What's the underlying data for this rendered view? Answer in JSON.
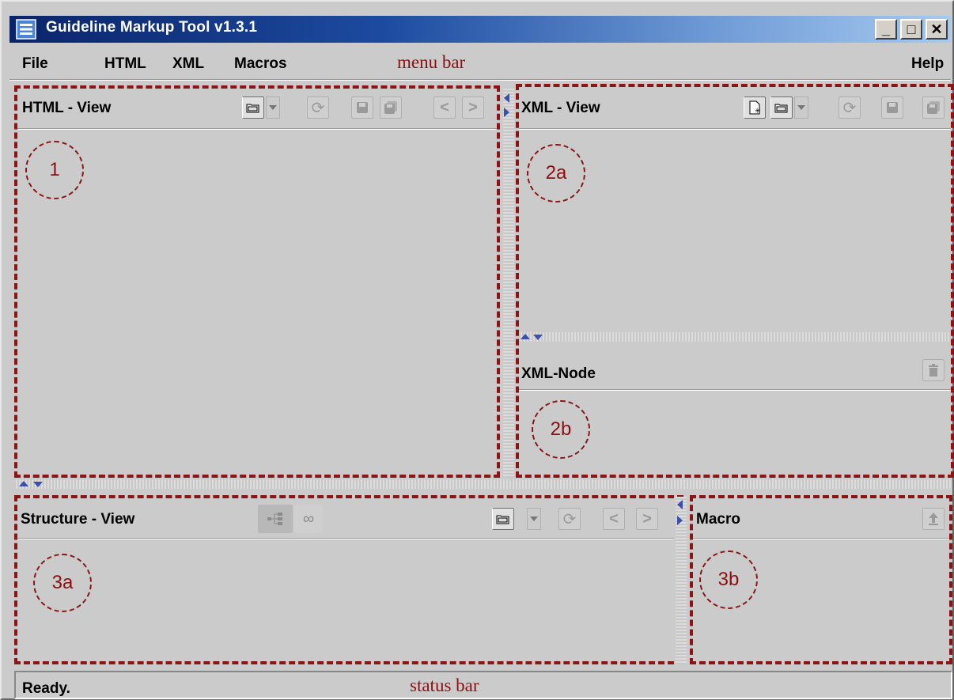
{
  "window": {
    "title": "Guideline Markup Tool v1.3.1"
  },
  "menu": {
    "file": "File",
    "html": "HTML",
    "xml": "XML",
    "macros": "Macros",
    "help": "Help"
  },
  "annotations": {
    "menu_bar": "menu bar",
    "status_bar": "status bar"
  },
  "panels": {
    "html_view": {
      "title": "HTML - View",
      "marker": "1"
    },
    "xml_view": {
      "title": "XML - View",
      "marker": "2a"
    },
    "xml_node": {
      "title": "XML-Node",
      "marker": "2b"
    },
    "structure_view": {
      "title": "Structure - View",
      "marker": "3a"
    },
    "macro": {
      "title": "Macro",
      "marker": "3b"
    }
  },
  "status": {
    "text": "Ready."
  },
  "colors": {
    "annotation": "#8b1515",
    "titlebar_start": "#0a246a",
    "titlebar_end": "#a6caf0",
    "window_bg": "#cbcbcb"
  },
  "icons": [
    "app-icon",
    "folder-open-icon",
    "dropdown-icon",
    "refresh-icon",
    "save-icon",
    "save-as-icon",
    "back-icon",
    "forward-icon",
    "new-document-icon",
    "trash-icon",
    "tree-icon",
    "binoculars-icon",
    "upload-icon"
  ]
}
